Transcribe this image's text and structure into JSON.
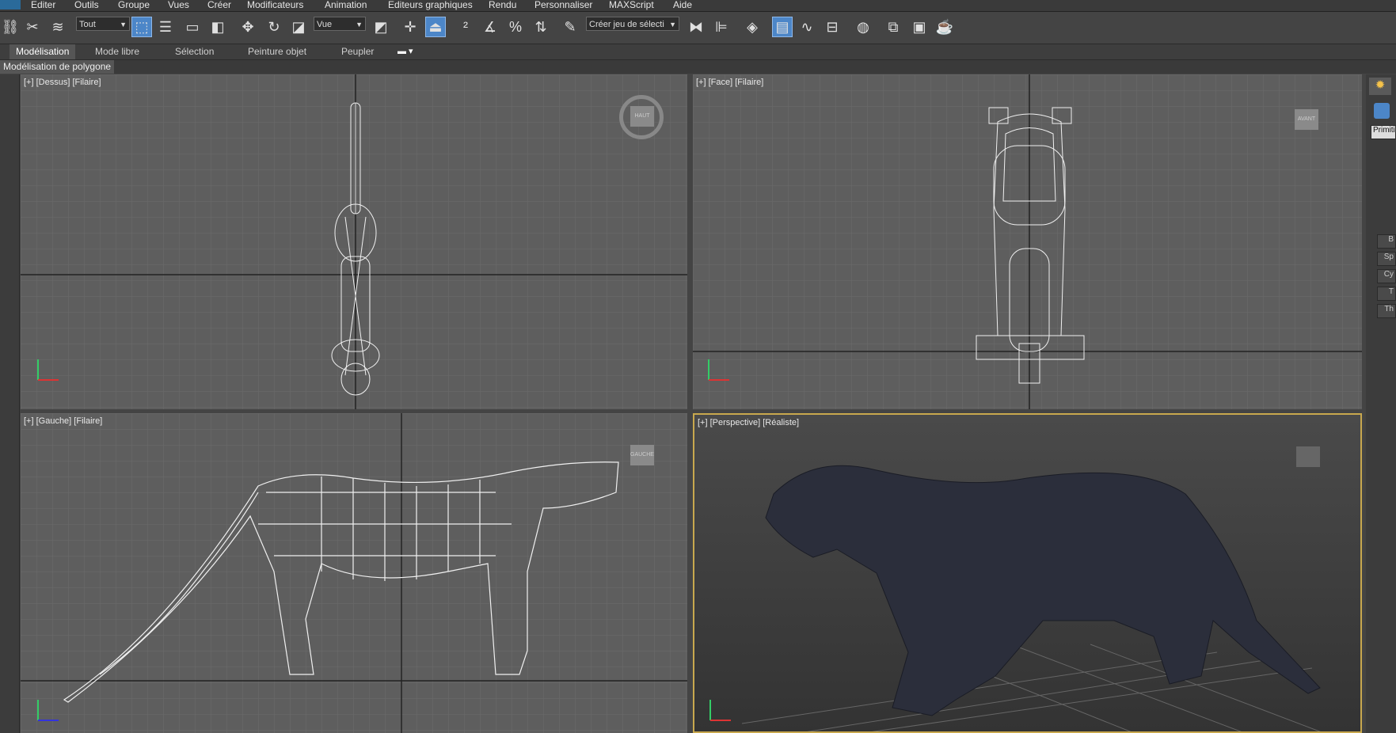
{
  "menu": {
    "items": [
      "Editer",
      "Outils",
      "Groupe",
      "Vues",
      "Créer",
      "Modificateurs",
      "Animation",
      "Editeurs graphiques",
      "Rendu",
      "Personnaliser",
      "MAXScript",
      "Aide"
    ]
  },
  "toolbar": {
    "selection_filter": "Tout",
    "reference_coord": "Vue",
    "named_selection_placeholder": "Créer jeu de sélecti"
  },
  "ribbon": {
    "tabs": [
      "Modélisation",
      "Mode libre",
      "Sélection",
      "Peinture objet",
      "Peupler"
    ],
    "sub_tab": "Modélisation de polygone"
  },
  "viewports": {
    "top": {
      "label": "[+] [Dessus] [Filaire]",
      "cube": "HAUT"
    },
    "front": {
      "label": "[+] [Face] [Filaire]",
      "cube": "AVANT"
    },
    "left": {
      "label": "[+] [Gauche] [Filaire]",
      "cube": "GAUCHE"
    },
    "perspective": {
      "label": "[+] [Perspective] [Réaliste]"
    }
  },
  "command_panel": {
    "dropdown": "Primiti",
    "items": [
      "B",
      "Sp",
      "Cy",
      "T",
      "Th"
    ]
  },
  "colors": {
    "active_viewport_border": "#c8a84e",
    "active_tool": "#4c86c8"
  }
}
